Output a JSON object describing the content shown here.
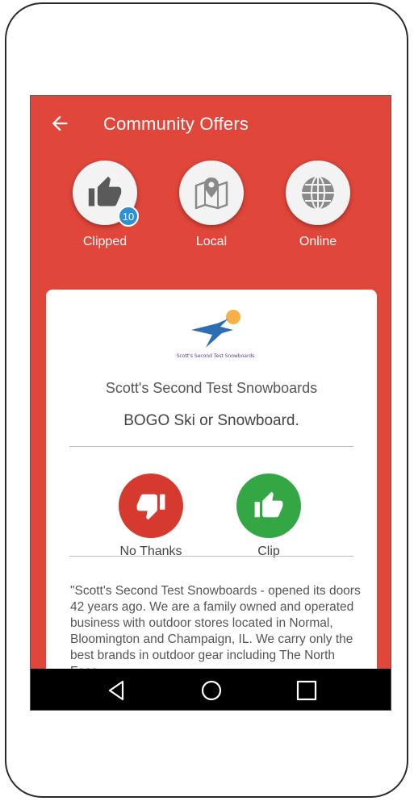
{
  "header": {
    "title": "Community Offers"
  },
  "nav": {
    "items": [
      {
        "label": "Clipped",
        "icon": "thumbs-up-icon",
        "badge": "10"
      },
      {
        "label": "Local",
        "icon": "map-pin-icon"
      },
      {
        "label": "Online",
        "icon": "globe-icon"
      }
    ]
  },
  "offer": {
    "logo_text": "Scott's Second Test Snowboards",
    "brand": "Scott's Second Test Snowboards",
    "title": "BOGO Ski or Snowboard.",
    "actions": {
      "decline_label": "No Thanks",
      "clip_label": "Clip"
    },
    "description": "\"Scott's Second Test Snowboards - opened its doors 42 years ago.  We are a family owned and operated business with outdoor stores located in Normal,  Bloomington and Champaign, IL. We carry only the best brands in outdoor gear including The North Face"
  },
  "colors": {
    "primary": "#e0463a",
    "decline": "#d63a2f",
    "clip": "#34a745",
    "badge": "#2d8fd5"
  },
  "system_nav": {
    "icons": [
      "back-triangle-icon",
      "home-circle-icon",
      "recents-square-icon"
    ]
  }
}
